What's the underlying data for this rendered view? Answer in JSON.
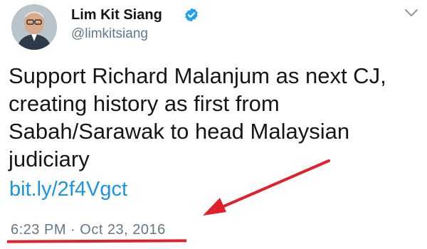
{
  "tweet": {
    "display_name": "Lim Kit Siang",
    "handle": "@limkitsiang",
    "text": "Support Richard Malanjum as next CJ, creating history as first from Sabah/Sarawak to head Malaysian judiciary",
    "link": "bit.ly/2f4Vgct",
    "timestamp": "6:23 PM · Oct 23, 2016"
  },
  "icons": {
    "verified": "verified-badge-icon",
    "menu": "chevron-down-icon"
  },
  "colors": {
    "link": "#1b95e0",
    "verified": "#1da1f2",
    "secondary_text": "#657786",
    "annotation_red": "#e0202a"
  }
}
